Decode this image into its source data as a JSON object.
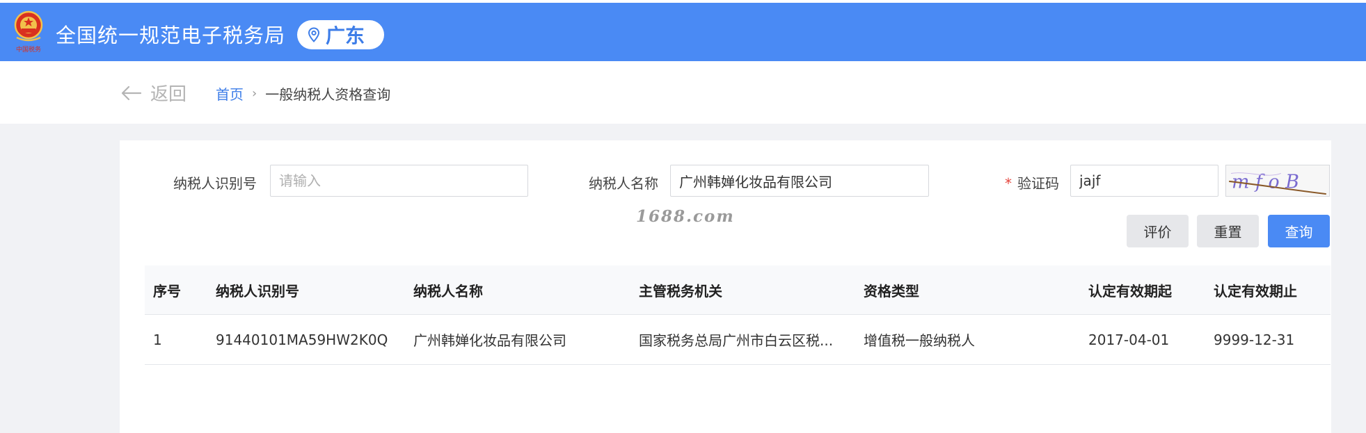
{
  "header": {
    "emblem_caption": "中国税务",
    "title": "全国统一规范电子税务局",
    "region": "广东"
  },
  "breadcrumb": {
    "back_label": "返回",
    "home": "首页",
    "separator": "›",
    "current": "一般纳税人资格查询"
  },
  "form": {
    "taxpayer_id": {
      "label": "纳税人识别号",
      "placeholder": "请输入",
      "value": ""
    },
    "taxpayer_name": {
      "label": "纳税人名称",
      "value": "广州韩婵化妆品有限公司"
    },
    "captcha": {
      "required_mark": "*",
      "label": "验证码",
      "value": "jajf",
      "image_text": "mfoB"
    }
  },
  "watermark": "1688.com",
  "buttons": {
    "evaluate": "评价",
    "reset": "重置",
    "query": "查询"
  },
  "table": {
    "columns": [
      "序号",
      "纳税人识别号",
      "纳税人名称",
      "主管税务机关",
      "资格类型",
      "认定有效期起",
      "认定有效期止"
    ],
    "rows": [
      [
        "1",
        "91440101MA59HW2K0Q",
        "广州韩婵化妆品有限公司",
        "国家税务总局广州市白云区税...",
        "增值税一般纳税人",
        "2017-04-01",
        "9999-12-31"
      ]
    ]
  },
  "colors": {
    "header_blue": "#4a8af4",
    "link_blue": "#3d7de8",
    "required_red": "#e5453d",
    "background": "#f1f2f5"
  },
  "icons": {
    "emblem": "tax-emblem-icon",
    "location": "location-pin-icon",
    "back": "arrow-left-icon"
  }
}
